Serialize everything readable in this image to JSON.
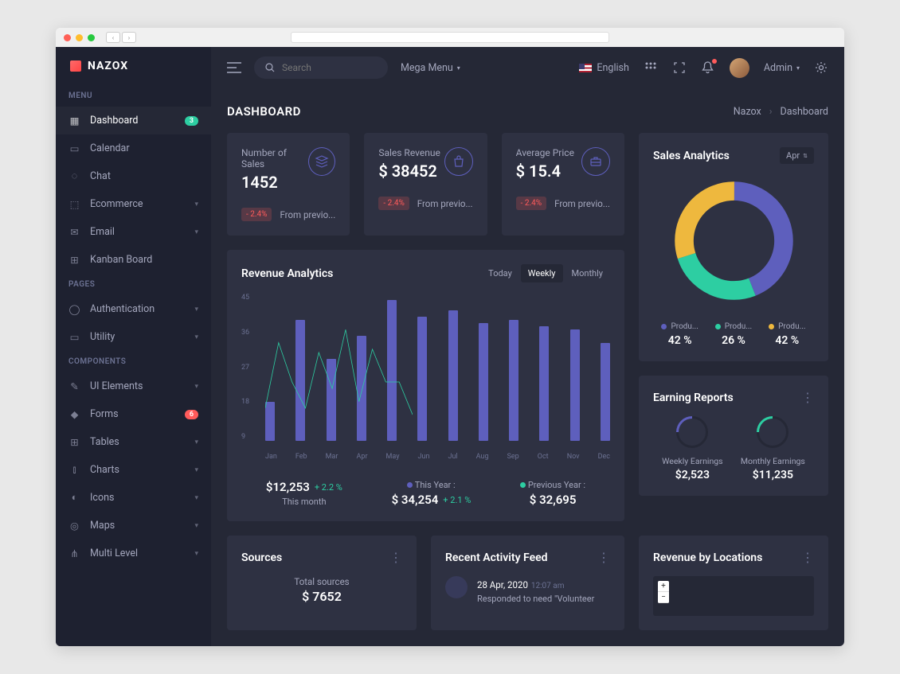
{
  "app_name": "NAZOX",
  "search": {
    "placeholder": "Search"
  },
  "mega_menu": "Mega Menu",
  "language": "English",
  "admin_label": "Admin",
  "sidebar": {
    "sections": {
      "menu": "MENU",
      "pages": "PAGES",
      "components": "COMPONENTS"
    },
    "items": {
      "dashboard": {
        "label": "Dashboard",
        "badge": "3"
      },
      "calendar": {
        "label": "Calendar"
      },
      "chat": {
        "label": "Chat"
      },
      "ecommerce": {
        "label": "Ecommerce"
      },
      "email": {
        "label": "Email"
      },
      "kanban": {
        "label": "Kanban Board"
      },
      "auth": {
        "label": "Authentication"
      },
      "utility": {
        "label": "Utility"
      },
      "ui": {
        "label": "UI Elements"
      },
      "forms": {
        "label": "Forms",
        "badge": "6"
      },
      "tables": {
        "label": "Tables"
      },
      "charts": {
        "label": "Charts"
      },
      "icons": {
        "label": "Icons"
      },
      "maps": {
        "label": "Maps"
      },
      "multi": {
        "label": "Multi Level"
      }
    }
  },
  "page": {
    "title": "DASHBOARD",
    "breadcrumb": {
      "root": "Nazox",
      "current": "Dashboard"
    }
  },
  "stats": {
    "sales": {
      "label": "Number of Sales",
      "value": "1452",
      "pct": "- 2.4%",
      "desc": "From previo..."
    },
    "revenue": {
      "label": "Sales Revenue",
      "value": "$ 38452",
      "pct": "- 2.4%",
      "desc": "From previo..."
    },
    "price": {
      "label": "Average Price",
      "value": "$ 15.4",
      "pct": "- 2.4%",
      "desc": "From previo..."
    }
  },
  "revenue_analytics": {
    "title": "Revenue Analytics",
    "tabs": {
      "today": "Today",
      "weekly": "Weekly",
      "monthly": "Monthly"
    },
    "footer": {
      "month": {
        "value": "$12,253",
        "pct": "+ 2.2 %",
        "label": "This month"
      },
      "year": {
        "label": "This Year :",
        "value": "$ 34,254",
        "pct": "+ 2.1 %"
      },
      "prev": {
        "label": "Previous Year :",
        "value": "$ 32,695"
      }
    }
  },
  "sales_analytics": {
    "title": "Sales Analytics",
    "selector": "Apr",
    "legend": {
      "a": {
        "label": "Produ...",
        "value": "42 %"
      },
      "b": {
        "label": "Produ...",
        "value": "26 %"
      },
      "c": {
        "label": "Produ...",
        "value": "42 %"
      }
    }
  },
  "earning": {
    "title": "Earning Reports",
    "weekly": {
      "label": "Weekly Earnings",
      "value": "$2,523"
    },
    "monthly": {
      "label": "Monthly Earnings",
      "value": "$11,235"
    }
  },
  "sources": {
    "title": "Sources",
    "label": "Total sources",
    "value": "$ 7652"
  },
  "activity": {
    "title": "Recent Activity Feed",
    "item": {
      "date": "28 Apr, 2020",
      "time": "12:07 am",
      "desc": "Responded to need \"Volunteer"
    }
  },
  "locations": {
    "title": "Revenue by Locations"
  },
  "chart_data": {
    "type": "bar+line",
    "title": "Revenue Analytics",
    "categories": [
      "Jan",
      "Feb",
      "Mar",
      "Apr",
      "May",
      "Jun",
      "Jul",
      "Aug",
      "Sep",
      "Oct",
      "Nov",
      "Dec"
    ],
    "ylim": [
      0,
      45
    ],
    "yticks": [
      45,
      36,
      27,
      18,
      9
    ],
    "series": [
      {
        "name": "bars",
        "values": [
          12,
          37,
          25,
          32,
          43,
          38,
          40,
          36,
          37,
          35,
          34,
          30
        ]
      },
      {
        "name": "line",
        "values": [
          10,
          30,
          18,
          10,
          27,
          16,
          34,
          12,
          28,
          18,
          18,
          8
        ]
      }
    ],
    "sales_donut": {
      "type": "pie",
      "values": [
        44,
        26,
        30
      ],
      "colors": [
        "#5e5fbd",
        "#2dcea2",
        "#eeb83e"
      ]
    }
  }
}
